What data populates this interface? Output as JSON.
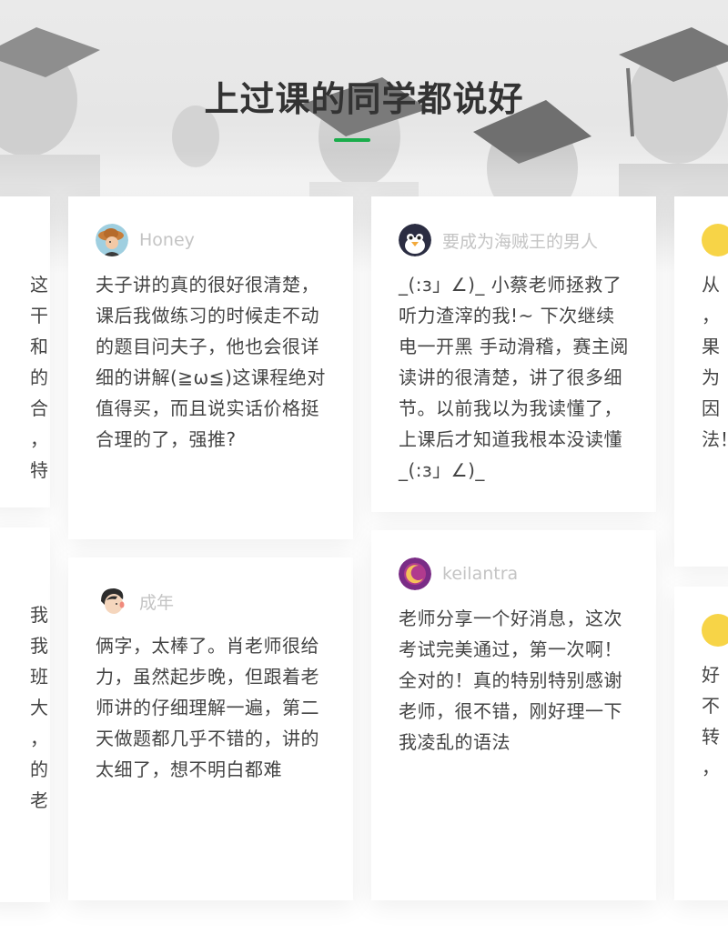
{
  "section": {
    "title": "上过课的同学都说好"
  },
  "reviews": [
    {
      "user": "Honey",
      "avatar_icon": "girl-with-hat-avatar-icon",
      "text": "夫子讲的真的很好很清楚，课后我做练习的时候走不动的题目问夫子，他也会很详细的讲解(≧ω≦)这课程绝对值得买，而且说实话价格挺合理的了，强推?"
    },
    {
      "user": "成年",
      "avatar_icon": "boy-cartoon-avatar-icon",
      "text": "俩字，太棒了。肖老师很给力，虽然起步晚，但跟着老师讲的仔细理解一遍，第二天做题都几乎不错的，讲的太细了，想不明白都难"
    },
    {
      "user": "要成为海贼王的男人",
      "avatar_icon": "penguin-avatar-icon",
      "text": "_(:з」∠)_ 小蔡老师拯救了听力渣滓的我!~ 下次继续电一开黑 手动滑稽，赛主阅读讲的很清楚，讲了很多细节。以前我以为我读懂了，上课后才知道我根本没读懂_(:з」∠)_"
    },
    {
      "user": "keilantra",
      "avatar_icon": "moon-avatar-icon",
      "text": "老师分享一个好消息，这次考试完美通过，第一次啊！全对的！真的特别特别感谢老师，很不错，刚好理一下我凌乱的语法"
    }
  ],
  "left_partial": {
    "top_lines": [
      "这",
      "干",
      "和",
      "的",
      "合",
      "，",
      "特"
    ],
    "bottom_lines": [
      "我",
      "我",
      "班",
      "大",
      "，",
      "的",
      "老"
    ]
  },
  "right_partial": {
    "top_lines": [
      "从",
      "，",
      "果",
      "为",
      "因",
      "法！"
    ],
    "bottom_lines": [
      "好",
      "不",
      "转",
      "，"
    ]
  },
  "colors": {
    "accent": "#1aad4b",
    "avatar_yellow": "#f7d447",
    "name_gray": "#c4c4c4",
    "text": "#444444"
  }
}
